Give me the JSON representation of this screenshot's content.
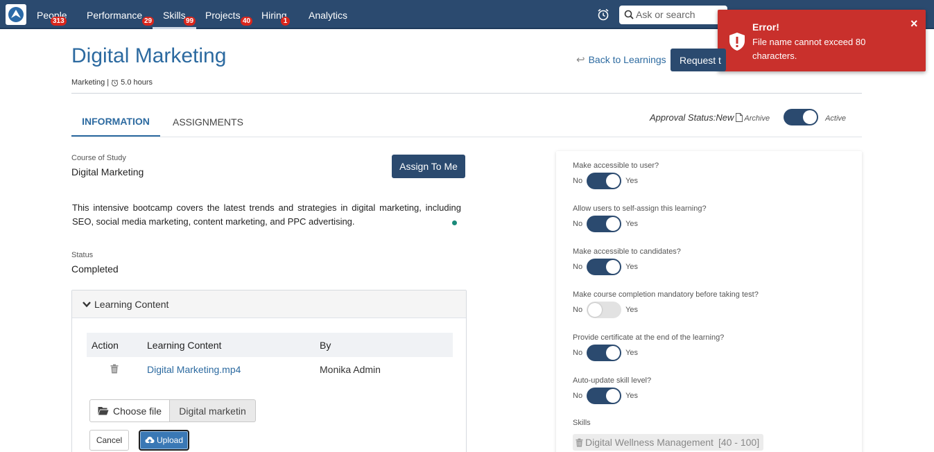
{
  "nav": {
    "items": [
      {
        "label": "People",
        "badge": "313"
      },
      {
        "label": "Performance",
        "badge": "29"
      },
      {
        "label": "Skills",
        "badge": "99"
      },
      {
        "label": "Projects",
        "badge": "40"
      },
      {
        "label": "Hiring",
        "badge": "1"
      },
      {
        "label": "Analytics",
        "badge": ""
      }
    ],
    "search_placeholder": "Ask or search"
  },
  "toast": {
    "title": "Error!",
    "message": "File name cannot exceed 80 characters.",
    "close": "×"
  },
  "header": {
    "title": "Digital Marketing",
    "category": "Marketing",
    "separator": "|",
    "duration": "5.0 hours",
    "back_link": "Back to Learnings",
    "request_button": "Request t"
  },
  "tabs": [
    "INFORMATION",
    "ASSIGNMENTS"
  ],
  "approval": {
    "label": "Approval Status:New",
    "archive": "Archive",
    "active": "Active"
  },
  "course": {
    "label": "Course of Study",
    "value": "Digital Marketing",
    "assign_button": "Assign To Me",
    "description": "This intensive bootcamp covers the latest trends and strategies in digital marketing, including SEO, social media marketing, content marketing, and PPC advertising.",
    "status_label": "Status",
    "status_value": "Completed"
  },
  "learning_content": {
    "title": "Learning Content",
    "columns": [
      "Action",
      "Learning Content",
      "By"
    ],
    "rows": [
      {
        "content": "Digital Marketing.mp4",
        "by": "Monika Admin"
      }
    ],
    "choose_file": "Choose file",
    "file_name": "Digital marketin",
    "cancel": "Cancel",
    "upload": "Upload"
  },
  "settings": {
    "no": "No",
    "yes": "Yes",
    "items": [
      {
        "question": "Make accessible to user?",
        "on": true
      },
      {
        "question": "Allow users to self-assign this learning?",
        "on": true
      },
      {
        "question": "Make accessible to candidates?",
        "on": true
      },
      {
        "question": "Make course completion mandatory before taking test?",
        "on": false
      },
      {
        "question": "Provide certificate at the end of the learning?",
        "on": true
      },
      {
        "question": "Auto-update skill level?",
        "on": true
      }
    ],
    "skills_label": "Skills",
    "skill": "Digital Wellness Management",
    "skill_range": "[40 - 100]"
  },
  "colors": {
    "nav_bg": "#2b4a6f",
    "accent": "#2c6aa0",
    "error": "#c9302c",
    "badge": "#d9261c"
  }
}
